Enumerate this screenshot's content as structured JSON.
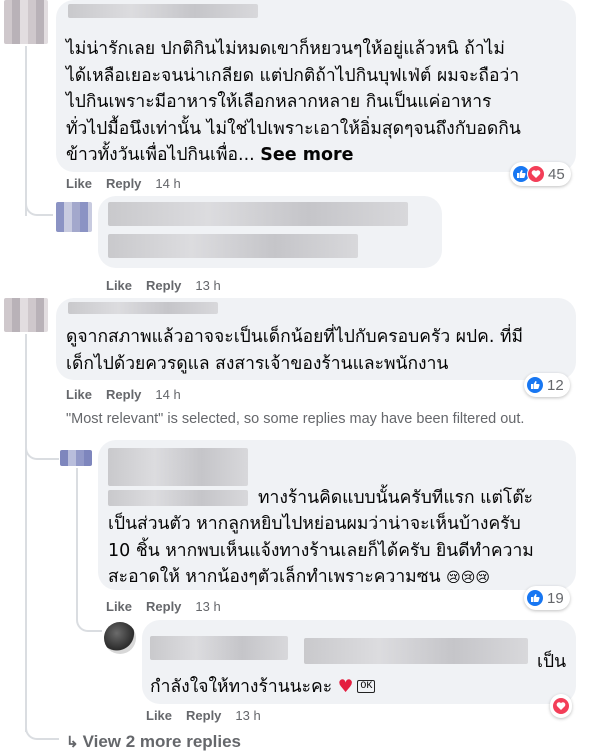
{
  "comment1": {
    "text_lines": [
      "ไม่น่ารักเลย ปกติกินไม่หมดเขาก็หยวนๆให้อยู่แล้วหนิ ถ้าไม่",
      "ได้เหลือเยอะจนน่าเกลียด แต่ปกติถ้าไปกินบุฟเฟ่ต์ ผมจะถือว่า",
      "ไปกินเพราะมีอาหารให้เลือกหลากหลาย กินเป็นแค่อาหาร",
      "ทั่วไปมื้อนึงเท่านั้น ไม่ใช่ไปเพราะเอาให้อิ่มสุดๆจนถึงกับอดกิน",
      "ข้าวทั้งวันเพื่อไปกินเพื่อ..."
    ],
    "see_more": "See more",
    "like": "Like",
    "reply": "Reply",
    "time": "14 h",
    "reaction_count": "45"
  },
  "comment1_reply": {
    "like": "Like",
    "reply": "Reply",
    "time": "13 h"
  },
  "comment2": {
    "text_lines": [
      "ดูจากสภาพแล้วอาจจะเป็นเด็กน้อยที่ไปกับครอบครัว ผปค. ที่มี",
      "เด็กไปด้วยควรดูแล สงสารเจ้าของร้านและพนักงาน"
    ],
    "like": "Like",
    "reply": "Reply",
    "time": "14 h",
    "reaction_count": "12"
  },
  "filter_note": "\"Most relevant\" is selected, so some replies may have been filtered out.",
  "comment2_reply1": {
    "text_lines": [
      "ทางร้านคิดแบบนั้นครับทีแรก แต่โต๊ะ",
      "เป็นส่วนตัว หากลูกหยิบไปหย่อนผมว่าน่าจะเห็นบ้างครับ",
      "10 ชิ้น หากพบเห็นแจ้งทางร้านเลยก็ได้ครับ ยินดีทำความ",
      "สะอาดให้ หากน้องๆตัวเล็กทำเพราะความซน"
    ],
    "emojis": "😢😢😢",
    "like": "Like",
    "reply": "Reply",
    "time": "13 h",
    "reaction_count": "19"
  },
  "comment2_reply2": {
    "text_lines": [
      "เป็น",
      "กำลังใจให้ทางร้านนะคะ"
    ],
    "heart": "♥",
    "ok_badge": "OK",
    "like": "Like",
    "reply": "Reply",
    "time": "13 h"
  },
  "view_more": {
    "arrow": "↳",
    "label": "View 2 more replies"
  },
  "colors": {
    "bubble": "#f0f2f5",
    "secondary_text": "#65676b",
    "like_blue": "#1877f2",
    "love_red": "#f33e58",
    "heart_red": "#e41e3f"
  }
}
